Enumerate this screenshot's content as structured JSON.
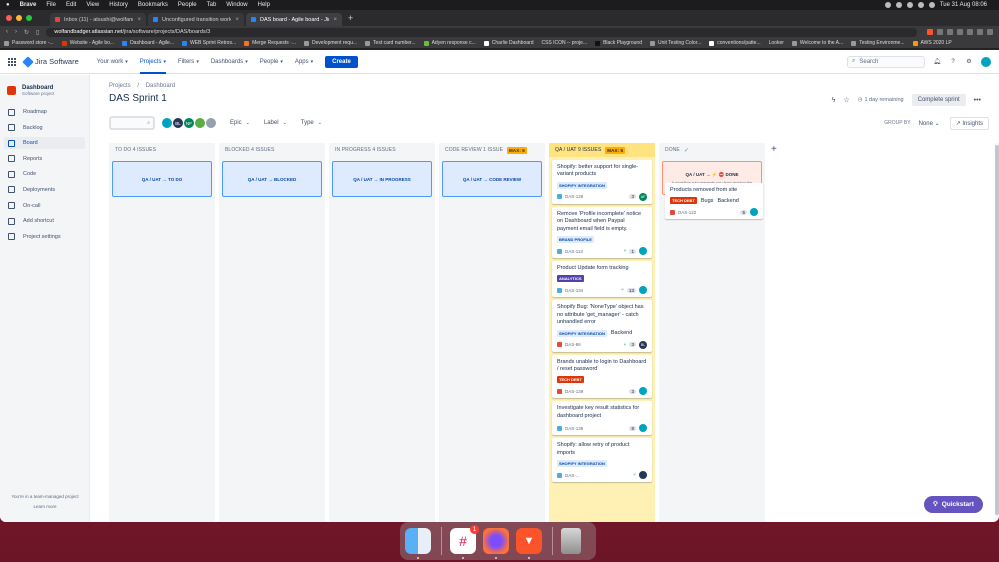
{
  "menubar": {
    "apple": "",
    "app": "Brave",
    "items": [
      "File",
      "Edit",
      "View",
      "History",
      "Bookmarks",
      "People",
      "Tab",
      "Window",
      "Help"
    ],
    "clock": "Tue 31 Aug  08:06"
  },
  "browser": {
    "tabs": [
      {
        "label": "Inbox (11) - atsushi@wolfandbadge...",
        "active": false
      },
      {
        "label": "Unconfigured transition workflow i...",
        "active": false
      },
      {
        "label": "DAS board - Agile board - Jira",
        "active": true
      }
    ],
    "url_host": "wolfandbadger.atlassian.net",
    "url_path": "/jira/software/projects/DAS/boards/3",
    "bookmarks": [
      "Password store -...",
      "Website - Agile bo...",
      "Dashboard - Agile...",
      "WEB Sprint Retros...",
      "Merge Requests ·...",
      "Development requ...",
      "Test card number...",
      "Adyen response c...",
      "Charlie Dashboard",
      "CSS ICON -- proje...",
      "Black Playground",
      "Unit Testing Color...",
      "conventions/patte...",
      "Looker",
      "Welcome to the A...",
      "Testing Environme...",
      "AWS 2020 LP"
    ]
  },
  "topnav": {
    "product": "Jira Software",
    "items": [
      {
        "label": "Your work",
        "active": false
      },
      {
        "label": "Projects",
        "active": true
      },
      {
        "label": "Filters",
        "active": false
      },
      {
        "label": "Dashboards",
        "active": false
      },
      {
        "label": "People",
        "active": false
      },
      {
        "label": "Apps",
        "active": false
      }
    ],
    "create": "Create",
    "search_placeholder": "Search"
  },
  "sidebar": {
    "project_name": "Dashboard",
    "project_type": "Software project",
    "items": [
      {
        "label": "Roadmap",
        "active": false
      },
      {
        "label": "Backlog",
        "active": false
      },
      {
        "label": "Board",
        "active": true
      },
      {
        "label": "Reports",
        "active": false
      },
      {
        "label": "Code",
        "active": false
      },
      {
        "label": "Deployments",
        "active": false
      },
      {
        "label": "On-call",
        "active": false
      },
      {
        "label": "Add shortcut",
        "active": false
      },
      {
        "label": "Project settings",
        "active": false
      }
    ],
    "footer_line1": "You're in a team-managed project",
    "footer_line2": "Learn more"
  },
  "board": {
    "breadcrumbs": [
      "Projects",
      "/",
      "Dashboard"
    ],
    "title": "DAS Sprint 1",
    "days_remaining": "1 day remaining",
    "complete_sprint": "Complete sprint",
    "filters": [
      "Epic",
      "Label",
      "Type"
    ],
    "avatars": [
      {
        "initials": "",
        "color": "#00a3bf"
      },
      {
        "initials": "BL",
        "color": "#253858"
      },
      {
        "initials": "NF",
        "color": "#00875a"
      },
      {
        "initials": "",
        "color": "#5aac44"
      },
      {
        "initials": "",
        "color": "#97a0af"
      }
    ],
    "group_by_label": "GROUP BY",
    "group_by_value": "None",
    "insights": "Insights",
    "columns": [
      {
        "title": "TO DO 4 ISSUES",
        "dropzone": "QA / UAT  →  TO DO"
      },
      {
        "title": "BLOCKED 4 ISSUES",
        "dropzone": "QA / UAT  →  BLOCKED"
      },
      {
        "title": "IN PROGRESS 4 ISSUES",
        "dropzone": "QA / UAT  →  IN PROGRESS"
      },
      {
        "title": "CODE REVIEW 1 ISSUE",
        "max": "MAX: 6",
        "dropzone": "QA / UAT  →  CODE REVIEW"
      },
      {
        "title": "QA / UAT 9 ISSUES",
        "max": "MAX: 5"
      },
      {
        "title": "DONE",
        "dropzone": "QA / UAT  →  ⚡ ⛔  DONE",
        "dropzone_sub": "A workflow rule prevents you from moving the"
      }
    ],
    "qa_cards": [
      {
        "summary": "Shopify: better support for single-variant products",
        "label": "SHOPIFY INTEGRATION",
        "label_style": "blue",
        "key": "DAS-128",
        "type": "story",
        "points": "3",
        "branch": "",
        "avatar": "AF",
        "avatar_color": "#00875a"
      },
      {
        "summary": "Remove 'Profile incomplete' notice on Dashboard when Paypal payment email field is empty.",
        "label": "BRAND PROFILE",
        "label_style": "blue",
        "key": "DAS-113",
        "type": "story",
        "points": "1",
        "branch": "⑂",
        "avatar": "",
        "avatar_color": "#00a3bf"
      },
      {
        "summary": "Product Update form tracking",
        "label": "ANALYTICS",
        "label_style": "purple",
        "key": "DAS-134",
        "type": "story",
        "points": "13",
        "branch": "⑂",
        "avatar": "",
        "avatar_color": "#00a3bf"
      },
      {
        "summary": "Shopify Bug: 'NoneType' object has no attribute 'get_manager' - catch unhandled error",
        "label": "SHOPIFY INTEGRATION",
        "label_style": "blue",
        "label2": "Backend",
        "key": "DAS-86",
        "type": "bug",
        "points": "3",
        "branch": "⑂",
        "avatar": "BL",
        "avatar_color": "#253858"
      },
      {
        "summary": "Brands unable to login to Dashboard / reset password",
        "label": "TECH DEBT",
        "label_style": "red",
        "key": "DAS-139",
        "type": "bug",
        "points": "3",
        "branch": "",
        "avatar": "",
        "avatar_color": "#00a3bf"
      },
      {
        "summary": "Investigate key result statistics for dashboard project",
        "label": "",
        "key": "DAS-135",
        "type": "story",
        "points": "8",
        "branch": "",
        "avatar": "",
        "avatar_color": "#00a3bf"
      },
      {
        "summary": "Shopify: allow retry of product imports",
        "label": "SHOPIFY INTEGRATION",
        "label_style": "blue",
        "key": "DAS-...",
        "type": "story",
        "points": "",
        "branch": "⑂",
        "avatar": "",
        "avatar_color": "#253858"
      }
    ],
    "done_card": {
      "summary": "Products removed from site",
      "label": "TECH DEBT",
      "label2": "Bugs",
      "label3": "Backend",
      "key": "DAS-122",
      "points": "5",
      "avatar": "",
      "avatar_color": "#00a3bf"
    },
    "quickstart": "Quickstart"
  }
}
